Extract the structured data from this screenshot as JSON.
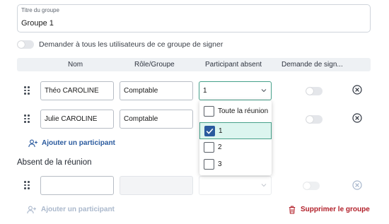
{
  "group": {
    "title_label": "Titre du groupe",
    "title_value": "Groupe 1",
    "ask_sign_label": "Demander à tous les utilisateurs de ce groupe de signer"
  },
  "table": {
    "headers": [
      "Nom",
      "Rôle/Groupe",
      "Participant absent",
      "Demande de sign..."
    ],
    "rows": [
      {
        "name": "Théo CAROLINE",
        "role": "Comptable",
        "absent": "1"
      },
      {
        "name": "Julie CAROLINE",
        "role": "Comptable",
        "absent": ""
      }
    ],
    "add_participant_label": "Ajouter un participant"
  },
  "dropdown": {
    "options": [
      {
        "label": "Toute la réunion",
        "checked": false
      },
      {
        "label": "1",
        "checked": true
      },
      {
        "label": "2",
        "checked": false
      },
      {
        "label": "3",
        "checked": false
      }
    ]
  },
  "absent_section": {
    "title": "Absent de la réunion",
    "add_participant_label": "Ajouter un participant",
    "delete_group_label": "Supprimer le groupe"
  },
  "colors": {
    "accent_green": "#46a08a",
    "selected_bg": "#dcf5ef",
    "link_blue": "#2a5a9e",
    "danger_red": "#b2202a"
  }
}
